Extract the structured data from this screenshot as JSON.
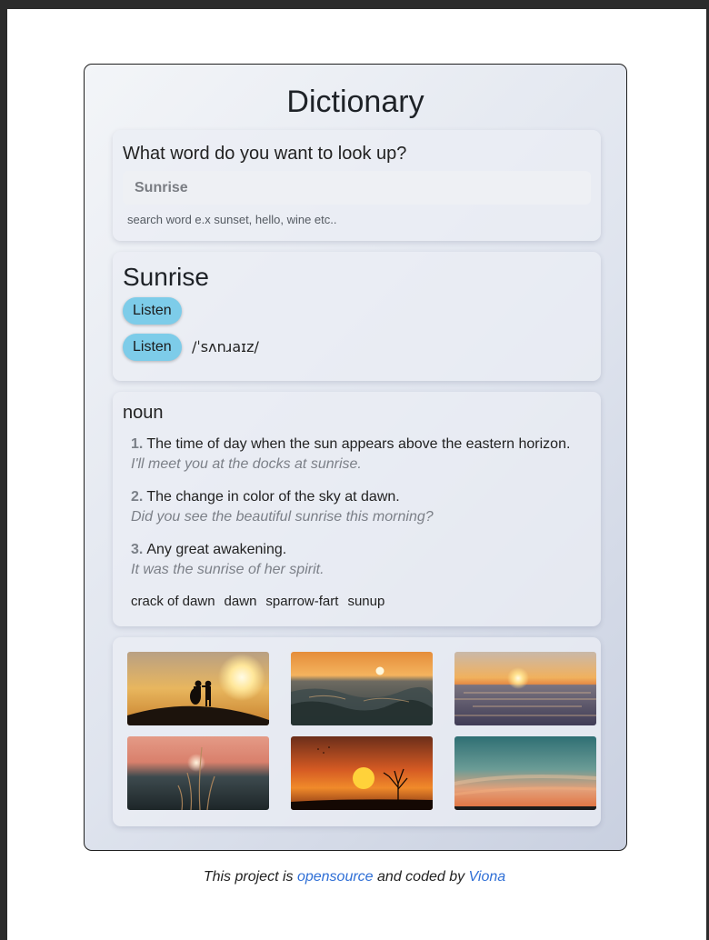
{
  "app": {
    "title": "Dictionary"
  },
  "search": {
    "question": "What word do you want to look up?",
    "value": "",
    "placeholder": "Sunrise",
    "hint": "search word e.x sunset, hello, wine etc.."
  },
  "word": {
    "title": "Sunrise",
    "listen_label_1": "Listen",
    "listen_label_2": "Listen",
    "phonetic": "/ˈsʌnɹaɪz/"
  },
  "meaning": {
    "part_of_speech": "noun",
    "definitions": [
      {
        "num": "1.",
        "text": "The time of day when the sun appears above the eastern horizon.",
        "example": "I'll meet you at the docks at sunrise."
      },
      {
        "num": "2.",
        "text": "The change in color of the sky at dawn.",
        "example": "Did you see the beautiful sunrise this morning?"
      },
      {
        "num": "3.",
        "text": "Any great awakening.",
        "example": "It was the sunrise of her spirit."
      }
    ],
    "synonyms": [
      "crack of dawn",
      "dawn",
      "sparrow-fart",
      "sunup"
    ]
  },
  "photos": [
    {
      "icon": "silhouette-couple-sunset-photo"
    },
    {
      "icon": "ocean-waves-sunset-photo"
    },
    {
      "icon": "sea-horizon-sunrise-photo"
    },
    {
      "icon": "grass-sunset-photo"
    },
    {
      "icon": "tree-orange-sunset-photo"
    },
    {
      "icon": "teal-sky-sunset-photo"
    }
  ],
  "footer": {
    "prefix": "This project is ",
    "link1": "opensource",
    "middle": " and coded by ",
    "link2": "Viona"
  },
  "colors": {
    "accent_button": "#7dcce9",
    "link": "#2f6fd6"
  }
}
